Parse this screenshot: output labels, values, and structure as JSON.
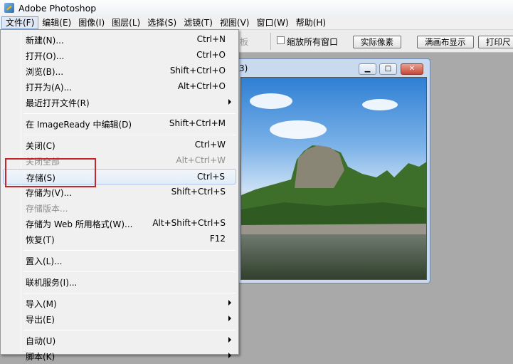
{
  "app": {
    "title": "Adobe Photoshop"
  },
  "menubar": {
    "items": [
      "文件(F)",
      "编辑(E)",
      "图像(I)",
      "图层(L)",
      "选择(S)",
      "滤镜(T)",
      "视图(V)",
      "窗口(W)",
      "帮助(H)"
    ]
  },
  "toolbar": {
    "partial_label": "板",
    "resize_all_windows_label": "缩放所有窗口",
    "actual_pixels_label": "实际像素",
    "fit_screen_label": "满画布显示",
    "print_size_label": "打印尺"
  },
  "document": {
    "title_fragment": "3)",
    "minimize_glyph": "▁",
    "maximize_glyph": "□",
    "close_glyph": "✕"
  },
  "file_menu": {
    "items": [
      {
        "label": "新建(N)...",
        "shortcut": "Ctrl+N",
        "submenu": false,
        "disabled": false
      },
      {
        "label": "打开(O)...",
        "shortcut": "Ctrl+O",
        "submenu": false,
        "disabled": false
      },
      {
        "label": "浏览(B)...",
        "shortcut": "Shift+Ctrl+O",
        "submenu": false,
        "disabled": false
      },
      {
        "label": "打开为(A)...",
        "shortcut": "Alt+Ctrl+O",
        "submenu": false,
        "disabled": false
      },
      {
        "label": "最近打开文件(R)",
        "shortcut": "",
        "submenu": true,
        "disabled": false
      },
      {
        "label": "在 ImageReady 中编辑(D)",
        "shortcut": "Shift+Ctrl+M",
        "submenu": false,
        "disabled": false
      },
      {
        "label": "关闭(C)",
        "shortcut": "Ctrl+W",
        "submenu": false,
        "disabled": false
      },
      {
        "label": "关闭全部",
        "shortcut": "Alt+Ctrl+W",
        "submenu": false,
        "disabled": true
      },
      {
        "label": "存储(S)",
        "shortcut": "Ctrl+S",
        "submenu": false,
        "disabled": false,
        "highlighted": true
      },
      {
        "label": "存储为(V)...",
        "shortcut": "Shift+Ctrl+S",
        "submenu": false,
        "disabled": false
      },
      {
        "label": "存储版本...",
        "shortcut": "",
        "submenu": false,
        "disabled": true
      },
      {
        "label": "存储为 Web 所用格式(W)...",
        "shortcut": "Alt+Shift+Ctrl+S",
        "submenu": false,
        "disabled": false
      },
      {
        "label": "恢复(T)",
        "shortcut": "F12",
        "submenu": false,
        "disabled": false
      },
      {
        "label": "置入(L)...",
        "shortcut": "",
        "submenu": false,
        "disabled": false
      },
      {
        "label": "联机服务(I)...",
        "shortcut": "",
        "submenu": false,
        "disabled": false
      },
      {
        "label": "导入(M)",
        "shortcut": "",
        "submenu": true,
        "disabled": false
      },
      {
        "label": "导出(E)",
        "shortcut": "",
        "submenu": true,
        "disabled": false
      },
      {
        "label": "自动(U)",
        "shortcut": "",
        "submenu": true,
        "disabled": false
      },
      {
        "label": "脚本(K)",
        "shortcut": "",
        "submenu": true,
        "disabled": false
      }
    ]
  },
  "colors": {
    "annotation_box": "#c6262a",
    "menu_highlight_border": "#aac6ea"
  }
}
